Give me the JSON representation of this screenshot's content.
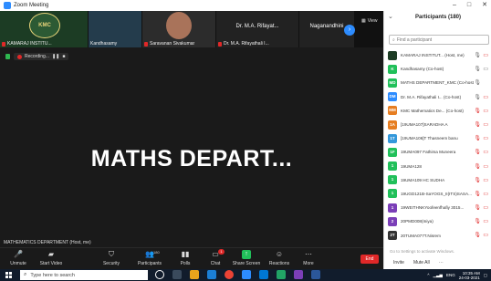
{
  "window": {
    "title": "Zoom Meeting",
    "controls": [
      "–",
      "□",
      "✕"
    ]
  },
  "gallery": {
    "tiles": [
      {
        "name": "KAMARAJ INSTITU..."
      },
      {
        "name": "Kandhasamy"
      },
      {
        "name": "Saravanan Sivakumar"
      },
      {
        "name": "Dr. M.A. Rifayathali I...",
        "display": "Dr. M.A. Rifayat..."
      },
      {
        "display": "Naganandhini"
      }
    ],
    "view_label": "View"
  },
  "recording": {
    "label": "Recording...",
    "pause": "❚❚",
    "stop": "■"
  },
  "share": {
    "title": "MATHS DEPART...",
    "speaker": "MATHEMATICS DEPARTMENT (Host, me)"
  },
  "toolbar": {
    "unmute": "Unmute",
    "start_video": "Start Video",
    "security": "Security",
    "participants": "Participants",
    "participants_count": "180",
    "polls": "Polls",
    "chat": "Chat",
    "chat_badge": "1",
    "share_screen": "Share Screen",
    "reactions": "Reactions",
    "more": "More",
    "end": "End"
  },
  "panel": {
    "title": "Participants (180)",
    "search_placeholder": "Find a participant",
    "participants": [
      {
        "initials": "",
        "name": "KAMARAJ INSTITUT... (Host, me)",
        "color": "#1c3c24",
        "mic": "on",
        "cam": "off"
      },
      {
        "initials": "K",
        "name": "Kandhasamy (Co-host)",
        "color": "#21c05a",
        "mic": "on",
        "cam": "on"
      },
      {
        "initials": "MD",
        "name": "MATHS DEPARTMENT_KMC (Co-host)",
        "color": "#21c05a",
        "mic": "on",
        "cam": "none"
      },
      {
        "initials": "DM",
        "name": "Dr. M.A. Rifayathali I... (Co-host)",
        "color": "#2d8cff",
        "mic": "on",
        "cam": "off"
      },
      {
        "initials": "MM",
        "name": "KMC Mathematics De... (Co-host)",
        "color": "#e67e22",
        "mic": "off",
        "cam": "off"
      },
      {
        "initials": "1A",
        "name": "[19UMA107]SARADHA A",
        "color": "#e67e22",
        "mic": "off",
        "cam": "off"
      },
      {
        "initials": "1T",
        "name": "[19UMA106]T Thasneem banu",
        "color": "#3498db",
        "mic": "off",
        "cam": "off"
      },
      {
        "initials": "1F",
        "name": "19UMA097 Fathima Muneera",
        "color": "#21c05a",
        "mic": "off",
        "cam": "off"
      },
      {
        "initials": "1",
        "name": "19UMA128",
        "color": "#21c05a",
        "mic": "off",
        "cam": "off"
      },
      {
        "initials": "1",
        "name": "19UMA109 HC SUDHA",
        "color": "#21c05a",
        "mic": "off",
        "cam": "off"
      },
      {
        "initials": "1",
        "name": "19UGD121B-SaYOGS_II(ITS)SASA...",
        "color": "#21c05a",
        "mic": "off",
        "cam": "off"
      },
      {
        "initials": "1",
        "name": "19WEITHNKYoofeenfhafiy 3015...",
        "color": "#7b3fb8",
        "mic": "off",
        "cam": "off"
      },
      {
        "initials": "2",
        "name": "20PMD008(Iniya)",
        "color": "#7b3fb8",
        "mic": "off",
        "cam": "off"
      },
      {
        "initials": "2T",
        "name": "20TUMA077T.Nisrem",
        "color": "#333333",
        "mic": "off",
        "cam": "off"
      }
    ],
    "invite": "Invite",
    "mute_all": "Mute All",
    "more": "⋯"
  },
  "activation_notice": "Go to Settings to activate Windows.",
  "taskbar": {
    "search_placeholder": "Type here to search",
    "lang": "ENG",
    "time": "10:35 AM",
    "date": "24-03-2021"
  },
  "colors": {
    "zoom_blue": "#2d8cff",
    "muted_red": "#e02828",
    "share_green": "#21c05a",
    "taskbar": "#111c2c"
  }
}
